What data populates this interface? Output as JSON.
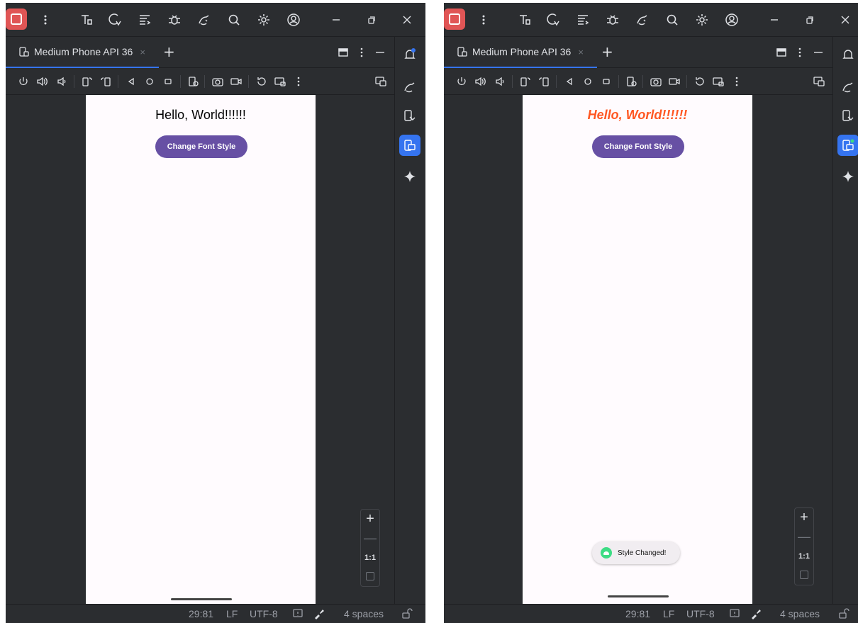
{
  "screens": [
    {
      "id": "before",
      "tab": {
        "label": "Medium Phone API 36",
        "close": "×"
      },
      "add_tab": "+",
      "app": {
        "hello_text": "Hello, World!!!!!!",
        "button_label": "Change Font Style"
      },
      "zoom": {
        "plus": "+",
        "minus": "—",
        "ratio": "1:1"
      },
      "status": {
        "position": "29:81",
        "line_ending": "LF",
        "encoding": "UTF-8",
        "indent": "4 spaces"
      }
    },
    {
      "id": "after",
      "tab": {
        "label": "Medium Phone API 36",
        "close": "×"
      },
      "add_tab": "+",
      "app": {
        "hello_text": "Hello, World!!!!!!",
        "button_label": "Change Font Style",
        "toast_text": "Style Changed!"
      },
      "zoom": {
        "plus": "+",
        "minus": "—",
        "ratio": "1:1"
      },
      "status": {
        "position": "29:81",
        "line_ending": "LF",
        "encoding": "UTF-8",
        "indent": "4 spaces"
      }
    }
  ],
  "icons": {
    "titlebar": [
      "stop-icon",
      "more-vertical-icon",
      "build-icon",
      "apply-changes-icon",
      "sync-icon",
      "debug-icon",
      "profiler-icon",
      "search-icon",
      "settings-icon",
      "account-icon",
      "minimize-icon",
      "restore-icon",
      "close-icon"
    ],
    "emulator_toolbar": [
      "power-icon",
      "volume-up-icon",
      "volume-down-icon",
      "rotate-left-icon",
      "rotate-right-icon",
      "back-icon",
      "home-icon",
      "overview-icon",
      "fold-icon",
      "screenshot-icon",
      "screen-record-icon",
      "snapshot-icon",
      "extended-controls-icon",
      "more-icon"
    ],
    "right_strip": [
      "notifications-icon",
      "gradle-icon",
      "device-manager-icon",
      "running-devices-icon",
      "gemini-icon"
    ]
  },
  "colors": {
    "ide_background": "#2b2d30",
    "accent": "#3574f0",
    "stop_button": "#e05555",
    "app_background": "#fffbfe",
    "button_purple": "#6750a4",
    "styled_text": "#ff5722",
    "toast_icon": "#3ddc84"
  }
}
